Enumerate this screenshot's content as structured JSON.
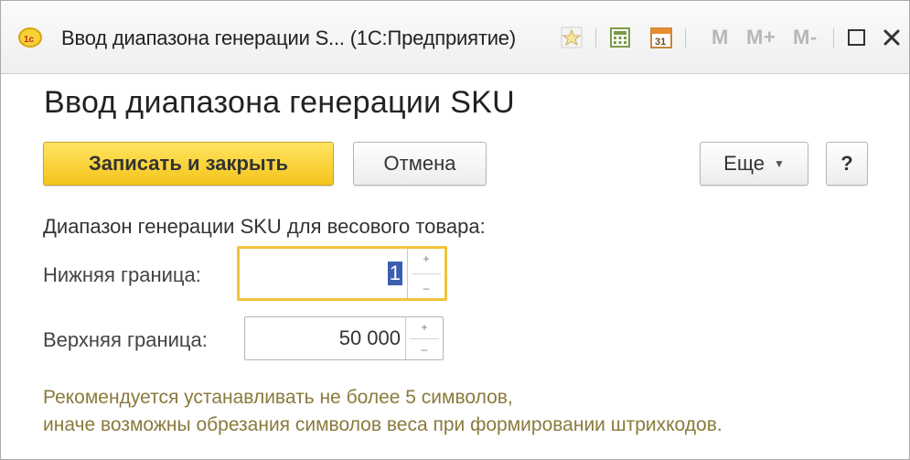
{
  "window": {
    "title": "Ввод диапазона генерации S...  (1С:Предприятие)",
    "memory_buttons": [
      "M",
      "M+",
      "M-"
    ],
    "icons": [
      "favorites-star-icon",
      "calculator-icon",
      "calendar-icon",
      "maximize-icon",
      "close-icon"
    ]
  },
  "form": {
    "title": "Ввод диапазона генерации SKU",
    "save_close_label": "Записать и закрыть",
    "cancel_label": "Отмена",
    "more_label": "Еще",
    "help_label": "?",
    "group_caption": "Диапазон генерации SKU для весового товара:",
    "lower_label": "Нижняя граница:",
    "lower_value": "1",
    "upper_label": "Верхняя граница:",
    "upper_value": "50 000",
    "note_line1": "Рекомендуется устанавливать не более 5 символов,",
    "note_line2": "иначе возможны обрезания символов веса при формировании штрихкодов."
  },
  "colors": {
    "primary_button": "#f5c41b",
    "focus_border": "#f0c33a",
    "note_text": "#8a7a3c"
  }
}
